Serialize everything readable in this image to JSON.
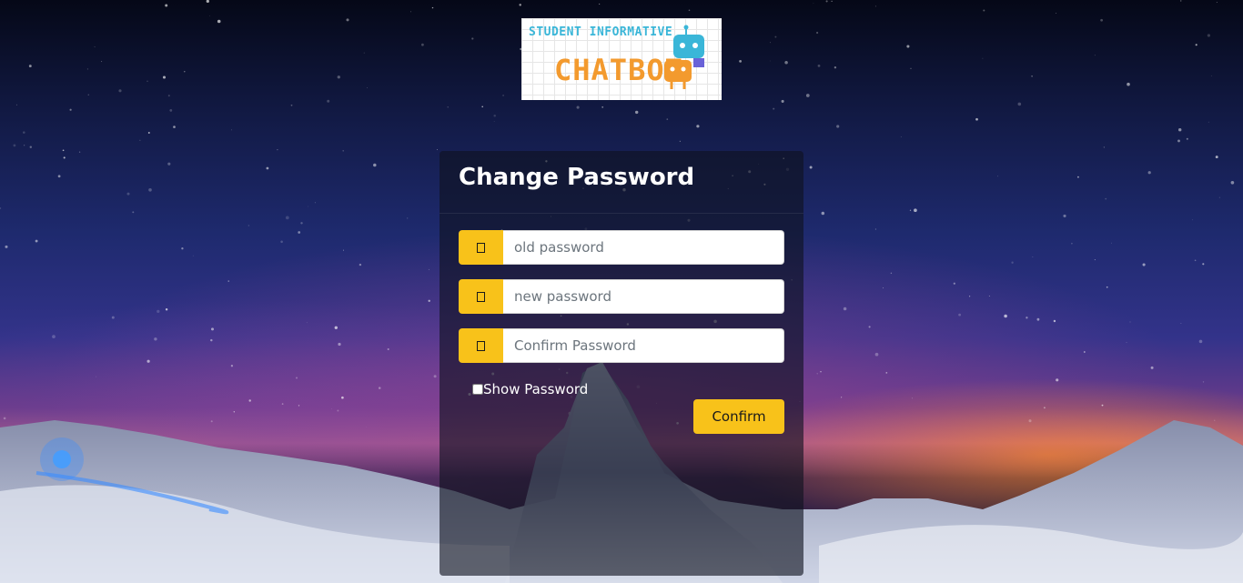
{
  "logo": {
    "top_text": "STUDENT INFORMATIVE",
    "main_text": "CHATBOT"
  },
  "form": {
    "title": "Change Password",
    "fields": [
      {
        "icon": "key-icon",
        "placeholder": "old password",
        "value": ""
      },
      {
        "icon": "key-icon",
        "placeholder": "new password",
        "value": ""
      },
      {
        "icon": "key-icon",
        "placeholder": "Confirm Password",
        "value": ""
      }
    ],
    "show_password_label": "Show Password",
    "show_password_checked": false,
    "confirm_label": "Confirm"
  },
  "colors": {
    "accent": "#f8c21a",
    "panel": "rgba(15,18,30,0.62)"
  }
}
